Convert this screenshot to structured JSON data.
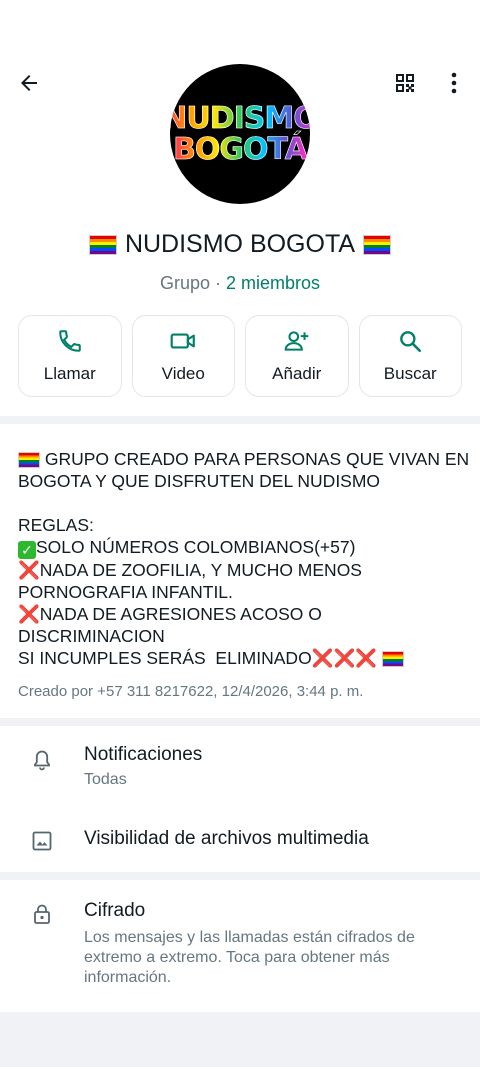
{
  "header": {
    "avatar_line1": "NUDISMO",
    "avatar_line2": "BOGOTÁ",
    "group_name": "NUDISMO BOGOTA",
    "subtitle_type": "Grupo",
    "subtitle_sep": " · ",
    "members": "2 miembros"
  },
  "actions": [
    {
      "label": "Llamar",
      "icon": "phone-icon"
    },
    {
      "label": "Video",
      "icon": "video-icon"
    },
    {
      "label": "Añadir",
      "icon": "add-person-icon"
    },
    {
      "label": "Buscar",
      "icon": "search-icon"
    }
  ],
  "description": {
    "line1": " GRUPO CREADO PARA PERSONAS QUE VIVAN EN",
    "line2": "BOGOTA Y QUE DISFRUTEN DEL NUDISMO",
    "line3": "REGLAS:",
    "line4": "SOLO NÚMEROS COLOMBIANOS(+57)",
    "line5": "NADA DE ZOOFILIA, Y MUCHO MENOS",
    "line6": "PORNOGRAFIA INFANTIL.",
    "line7": "NADA DE AGRESIONES ACOSO O",
    "line8": "DISCRIMINACION",
    "line9": "SI INCUMPLES SERÁS  ELIMINADO",
    "cross": "❌",
    "created": "Creado por +57 311 8217622, 12/4/2026, 3:44 p. m."
  },
  "settings": {
    "notifications_title": "Notificaciones",
    "notifications_value": "Todas",
    "media_visibility": "Visibilidad de archivos multimedia"
  },
  "encryption": {
    "title": "Cifrado",
    "description": "Los mensajes y las llamadas están cifrados de extremo a extremo. Toca para obtener más información."
  },
  "colors": {
    "accent": "#008069",
    "background": "#f0f2f5",
    "secondary_text": "#667781"
  }
}
